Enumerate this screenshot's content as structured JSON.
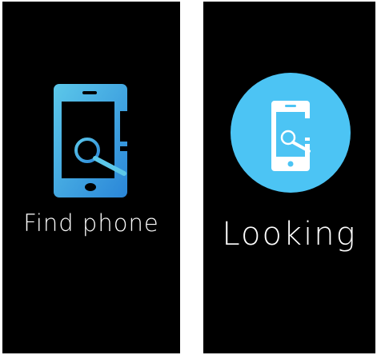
{
  "colors": {
    "background": "#000000",
    "text": "#ffffff",
    "accent": "#4cc4f4",
    "accent_gradient_start": "#4fc3e8",
    "accent_gradient_end": "#2a86d8"
  },
  "screens": [
    {
      "icon": "phone-search-icon",
      "label": "Find phone"
    },
    {
      "icon": "phone-search-circle-icon",
      "label": "Looking"
    }
  ]
}
